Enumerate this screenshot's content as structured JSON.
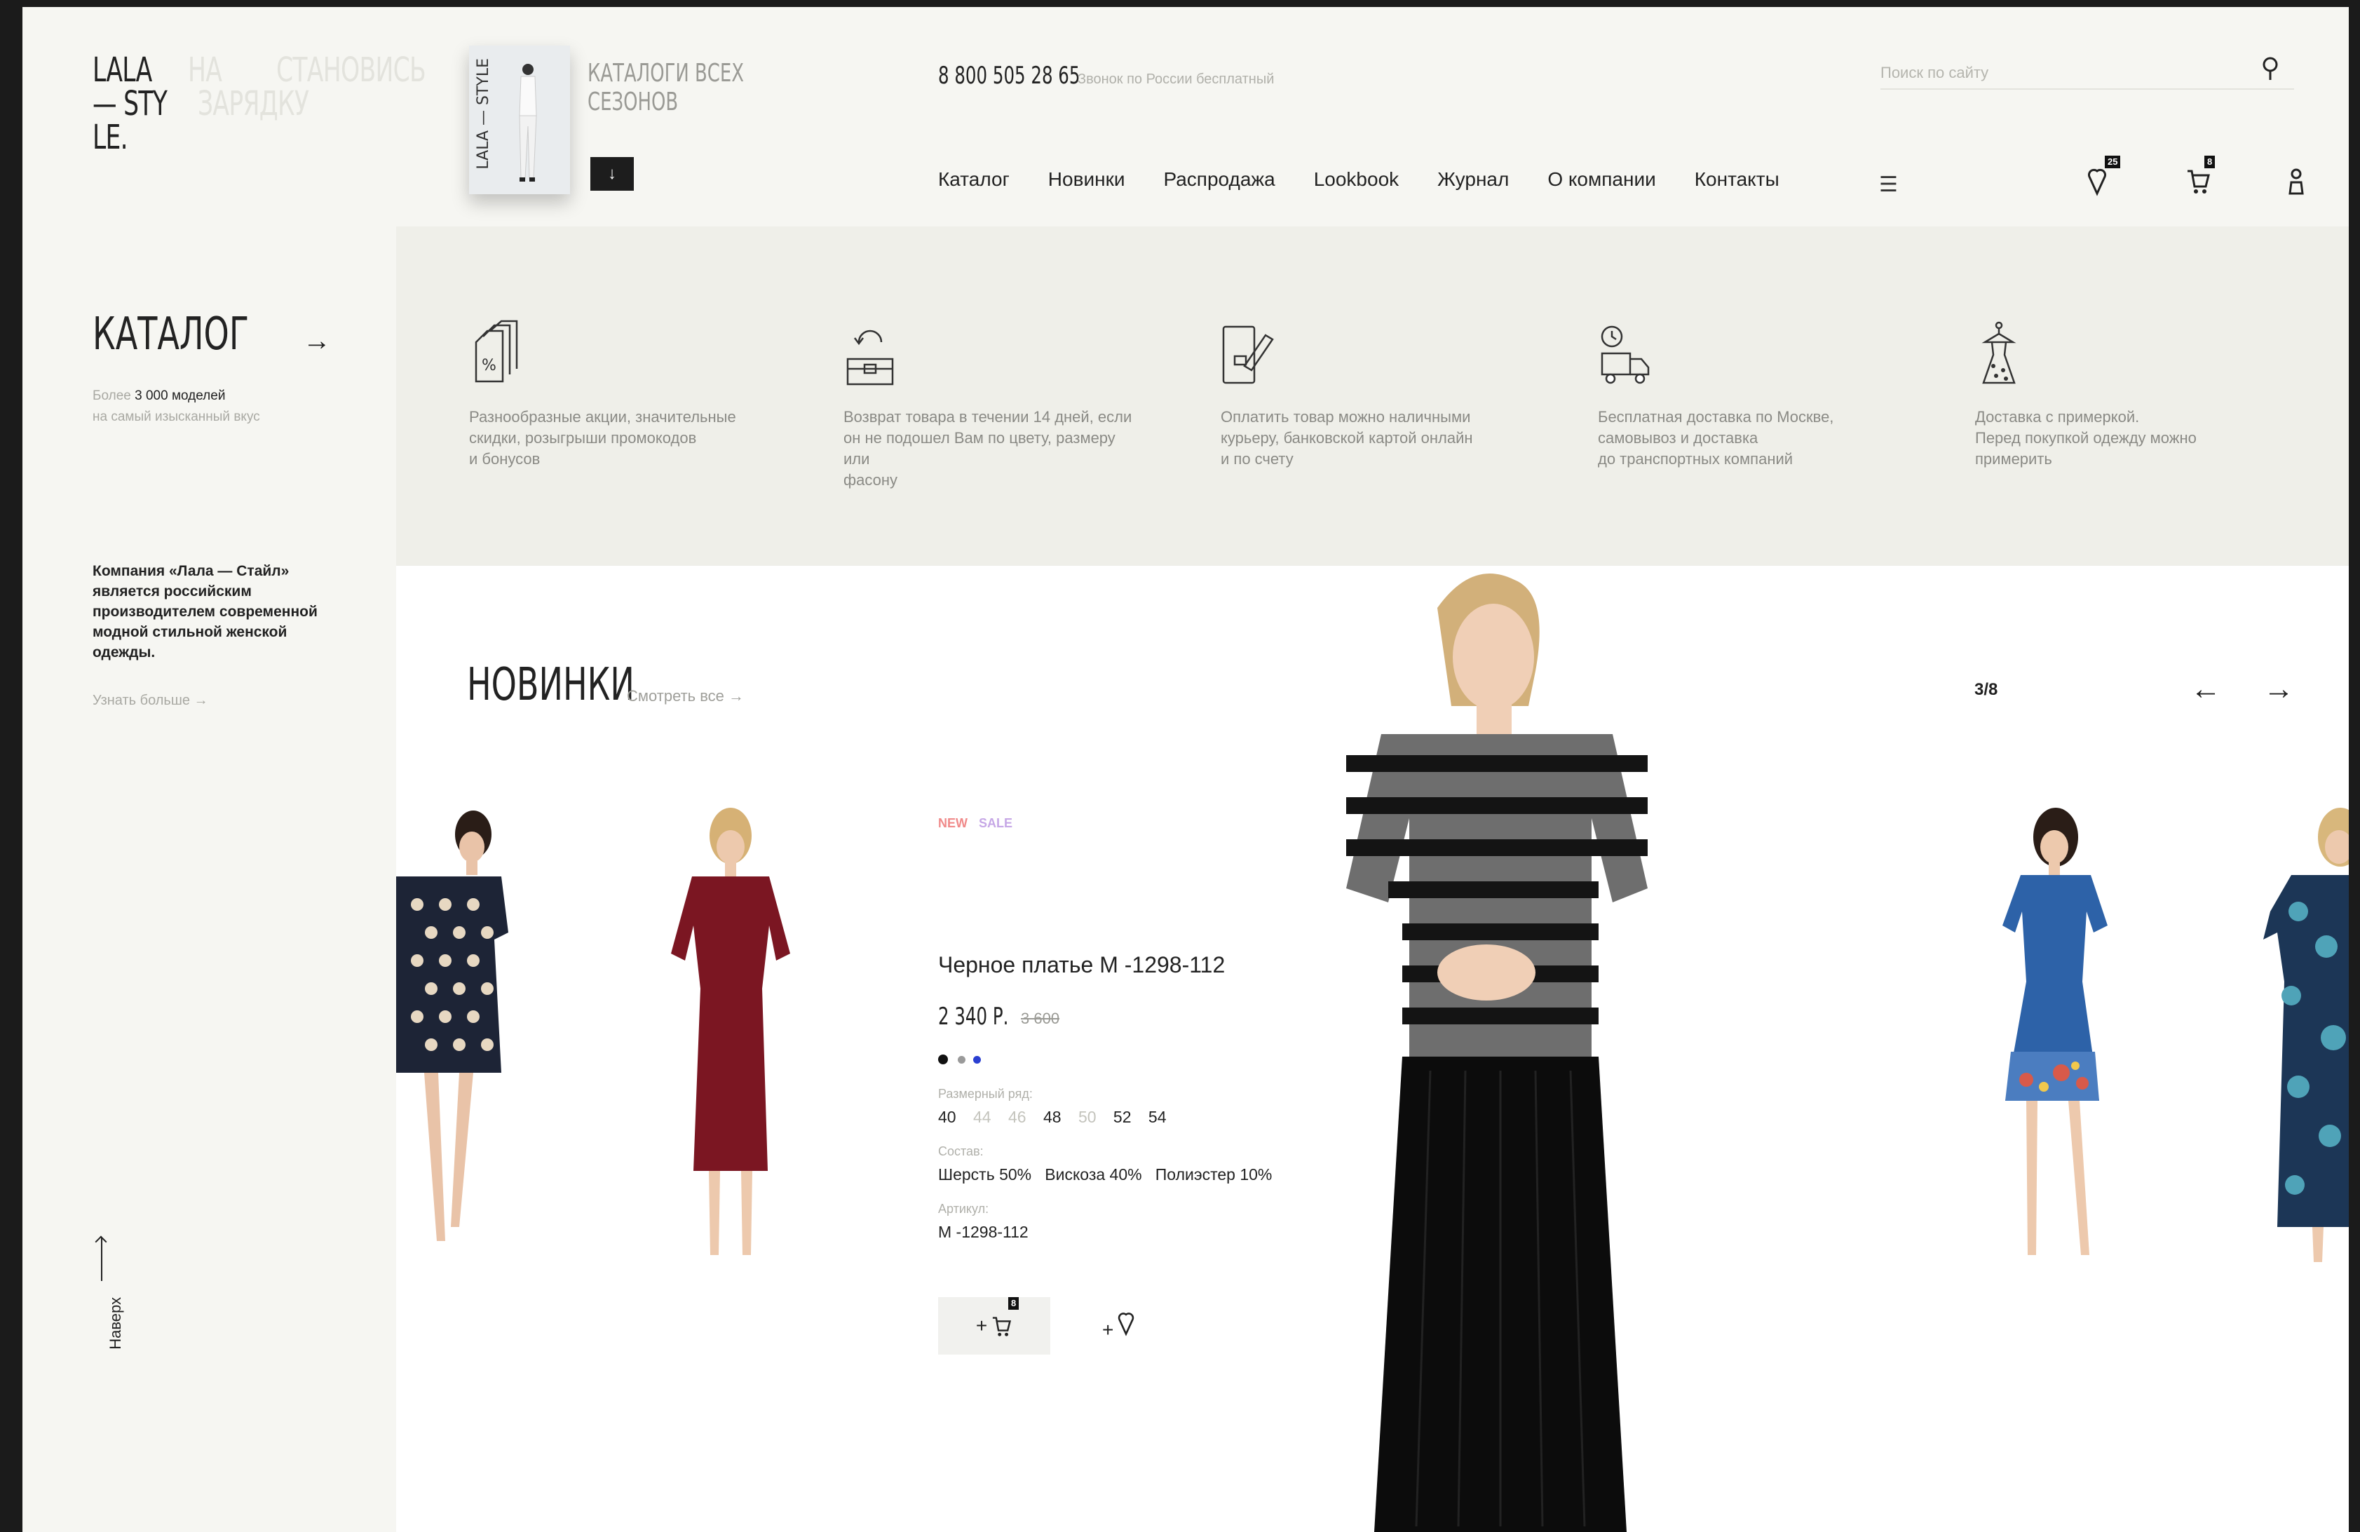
{
  "header": {
    "logo": {
      "lines": [
        "LALA",
        "— STY",
        "LE."
      ],
      "ghost_words": [
        "НА",
        "СТАНОВИСЬ",
        "ЗАРЯДКУ"
      ]
    },
    "catalog_promo": {
      "cover_text": "LALA — STYLE",
      "title_line1": "КАТАЛОГИ ВСЕХ",
      "title_line2": "СЕЗОНОВ",
      "download_icon": "arrow-down-icon"
    },
    "phone": "8 800 505 28 65",
    "phone_note": "Звонок по России бесплатный",
    "search": {
      "placeholder": "Поиск по сайту",
      "icon": "search-icon"
    },
    "nav": [
      "Каталог",
      "Новинки",
      "Распродажа",
      "Lookbook",
      "Журнал",
      "О компании",
      "Контакты"
    ],
    "menu_icon": "☰",
    "favorites_count": "25",
    "cart_count": "8"
  },
  "sidebar": {
    "catalog_title": "КАТАЛОГ",
    "catalog_sub_prefix": "Более ",
    "catalog_sub_bold": "3 000 моделей",
    "catalog_sub_line2": "на самый изысканный вкус",
    "about": "Компания «Лала — Стайл» является российским производителем современной модной стильной женской одежды.",
    "more": "Узнать больше",
    "up": "Наверх"
  },
  "features": [
    {
      "icon": "discount-tag-icon",
      "text": [
        "Разнообразные акции, значительные",
        "скидки, розыгрыши промокодов",
        "и бонусов"
      ]
    },
    {
      "icon": "return-box-icon",
      "text": [
        "Возврат товара в течении 14 дней, если",
        "он не подошел Вам по цвету, размеру или",
        "фасону"
      ]
    },
    {
      "icon": "payment-card-icon",
      "text": [
        "Оплатить товар можно наличными",
        "курьеру, банковской картой онлайн",
        "и по счету"
      ]
    },
    {
      "icon": "delivery-truck-icon",
      "text": [
        "Бесплатная доставка по Москве,",
        "самовывоз и доставка",
        "до транспортных компаний"
      ]
    },
    {
      "icon": "dress-hanger-icon",
      "text": [
        "Доставка с примеркой.",
        "Перед покупкой одежду можно",
        "примерить"
      ]
    }
  ],
  "new_items": {
    "title": "НОВИНКИ",
    "see_all": "Смотреть все",
    "counter": "3/8",
    "product": {
      "tag_new": "NEW",
      "tag_sale": "SALE",
      "name": "Черное платье М -1298-112",
      "price": "2 340 Р.",
      "old_price": "3 600",
      "colors": [
        "#111111",
        "#9a9a9a",
        "#2a3fd1"
      ],
      "size_label": "Размерный ряд:",
      "sizes": [
        {
          "v": "40",
          "available": true
        },
        {
          "v": "44",
          "available": false
        },
        {
          "v": "46",
          "available": false
        },
        {
          "v": "48",
          "available": true
        },
        {
          "v": "50",
          "available": false
        },
        {
          "v": "52",
          "available": true
        },
        {
          "v": "54",
          "available": true
        }
      ],
      "composition_label": "Состав:",
      "composition": [
        "Шерсть 50%",
        "Вискоза 40%",
        "Полиэстер 10%"
      ],
      "article_label": "Артикул:",
      "article": "М -1298-112",
      "cart_count": "8"
    }
  }
}
